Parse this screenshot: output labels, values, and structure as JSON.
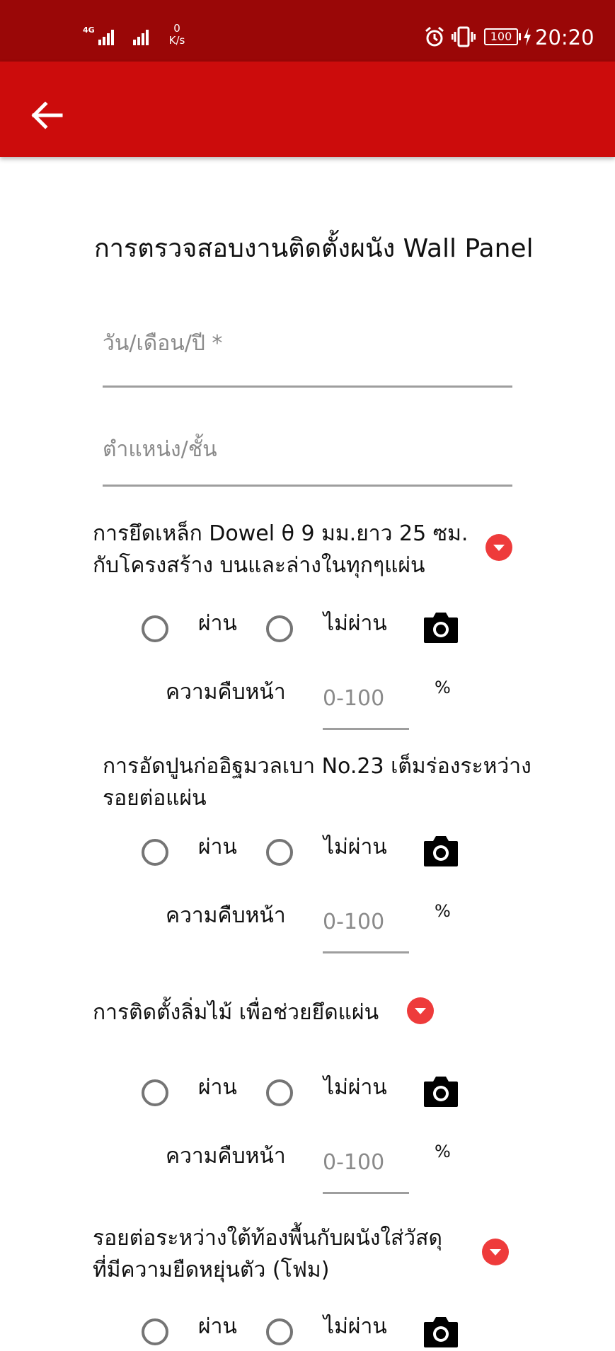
{
  "status_bar": {
    "network_type": "4G",
    "speed_value": "0",
    "speed_unit": "K/s",
    "battery": "100",
    "time": "20:20"
  },
  "form": {
    "title": "การตรวจสอบงานติดตั้งผนัง Wall Panel",
    "date_placeholder": "วัน/เดือน/ปี *",
    "position_placeholder": "ตำแหน่ง/ชั้น"
  },
  "items": [
    {
      "question_line1": "การยึดเหล็ก Dowel θ 9 มม.ยาว 25 ซม.",
      "question_line2": "กับโครงสร้าง บนและล่างในทุกๆแผ่น",
      "pass_label": "ผ่าน",
      "fail_label": "ไม่ผ่าน",
      "progress_label": "ความคืบหน้า",
      "progress_placeholder": "0-100",
      "percent": "%"
    },
    {
      "question_line1": "การอัดปูนก่ออิฐมวลเบา No.23 เต็มร่องระหว่าง",
      "question_line2": "รอยต่อแผ่น",
      "pass_label": "ผ่าน",
      "fail_label": "ไม่ผ่าน",
      "progress_label": "ความคืบหน้า",
      "progress_placeholder": "0-100",
      "percent": "%"
    },
    {
      "question_line1": "การติดตั้งลิ่มไม้ เพื่อช่วยยึดแผ่น",
      "question_line2": "",
      "pass_label": "ผ่าน",
      "fail_label": "ไม่ผ่าน",
      "progress_label": "ความคืบหน้า",
      "progress_placeholder": "0-100",
      "percent": "%"
    },
    {
      "question_line1": "รอยต่อระหว่างใต้ท้องพื้นกับผนังใส่วัสดุ",
      "question_line2": "ที่มีความยืดหยุ่นตัว (โฟม)",
      "pass_label": "ผ่าน",
      "fail_label": "ไม่ผ่าน"
    }
  ],
  "colors": {
    "status_bar": "#9a0707",
    "app_bar": "#cc0c0c",
    "accent": "#ee3b3b"
  }
}
